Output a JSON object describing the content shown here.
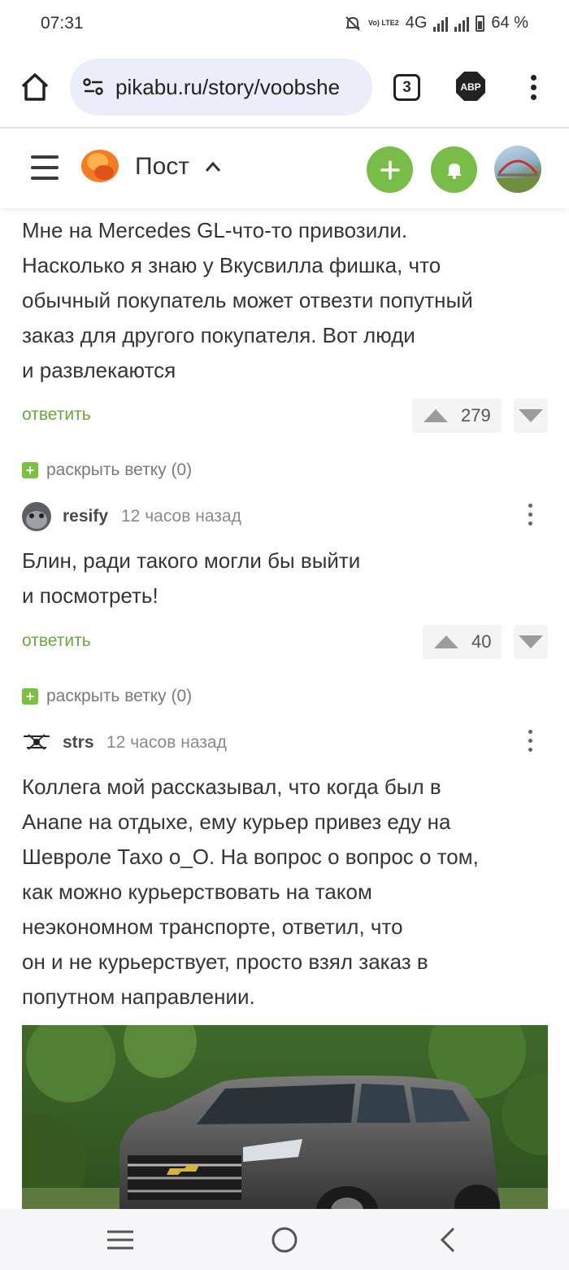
{
  "status_bar": {
    "time": "07:31",
    "network": "4G",
    "lte_label": "Vo) LTE2",
    "battery": "64 %"
  },
  "browser": {
    "url": "pikabu.ru/story/voobshe",
    "tab_count": "3",
    "adblock_label": "ABP"
  },
  "site_header": {
    "section_title": "Пост",
    "accent_color": "#78bd48"
  },
  "comments": [
    {
      "text_lines": [
        "Мне на Mercedes GL-что-то привозили.",
        "Насколько я знаю у Вкусвилла фишка, что",
        "обычный покупатель может отвезти попутный",
        "заказ для другого покупателя. Вот люди",
        "и развлекаются"
      ],
      "reply_label": "ответить",
      "rating": "279",
      "expand_label": "раскрыть ветку (0)"
    },
    {
      "author": "resify",
      "time": "12 часов назад",
      "text_lines": [
        "Блин, ради такого могли бы выйти",
        "и посмотреть!"
      ],
      "reply_label": "ответить",
      "rating": "40",
      "expand_label": "раскрыть ветку (0)"
    },
    {
      "author": "strs",
      "time": "12 часов назад",
      "text_lines": [
        "Коллега мой рассказывал, что когда был в",
        "Анапе на отдыхе, ему курьер привез еду на",
        "Шевроле Тахо о_О. На вопрос о вопрос о том,",
        "как можно курьерствовать на таком",
        "неэкономном транспорте, ответил, что",
        "он и не курьерствует, просто взял заказ в",
        "попутном направлении."
      ],
      "image": "chevrolet-tahoe-photo"
    }
  ]
}
